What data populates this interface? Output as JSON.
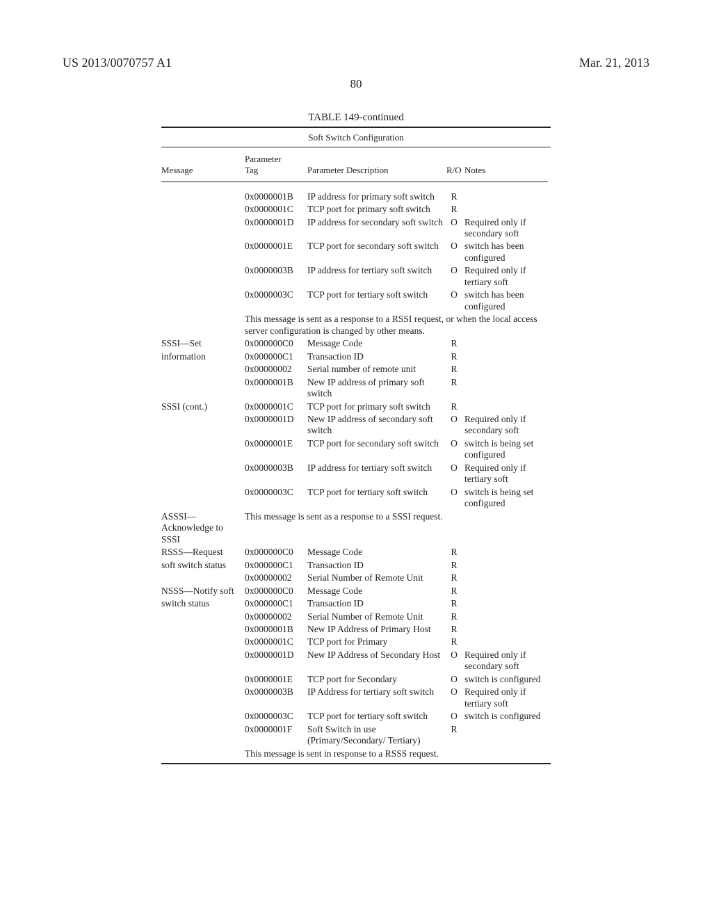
{
  "header": {
    "pub_number": "US 2013/0070757 A1",
    "pub_date": "Mar. 21, 2013",
    "page_number": "80"
  },
  "table": {
    "title": "TABLE 149-continued",
    "subtitle": "Soft Switch Configuration",
    "columns": {
      "message": "Message",
      "tag_top": "Parameter",
      "tag_bottom": "Tag",
      "desc": "Parameter Description",
      "ro": "R/O",
      "notes": "Notes"
    },
    "rows": [
      {
        "msg": "",
        "tag": "0x0000001B",
        "desc": "IP address for primary soft switch",
        "ro": "R",
        "notes": ""
      },
      {
        "msg": "",
        "tag": "0x0000001C",
        "desc": "TCP port for primary soft switch",
        "ro": "R",
        "notes": ""
      },
      {
        "msg": "",
        "tag": "0x0000001D",
        "desc": "IP address for secondary soft switch",
        "ro": "O",
        "notes": "Required only if secondary soft"
      },
      {
        "msg": "",
        "tag": "0x0000001E",
        "desc": "TCP port for secondary soft switch",
        "ro": "O",
        "notes": "switch has been configured"
      },
      {
        "msg": "",
        "tag": "0x0000003B",
        "desc": "IP address for tertiary soft switch",
        "ro": "O",
        "notes": "Required only if tertiary soft"
      },
      {
        "msg": "",
        "tag": "0x0000003C",
        "desc": "TCP port for tertiary soft switch",
        "ro": "O",
        "notes": "switch has been configured"
      },
      {
        "section_note": "This message is sent as a response to a RSSI request, or when the local access server configuration is changed by other means."
      },
      {
        "msg": "SSSI—Set",
        "tag": "0x000000C0",
        "desc": "Message Code",
        "ro": "R",
        "notes": ""
      },
      {
        "msg": "information",
        "tag": "0x000000C1",
        "desc": "Transaction ID",
        "ro": "R",
        "notes": ""
      },
      {
        "msg": "",
        "tag": "0x00000002",
        "desc": "Serial number of remote unit",
        "ro": "R",
        "notes": ""
      },
      {
        "msg": "",
        "tag": "0x0000001B",
        "desc": "New IP address of primary soft switch",
        "ro": "R",
        "notes": ""
      },
      {
        "msg": "SSSI (cont.)",
        "tag": "0x0000001C",
        "desc": "TCP port for primary soft switch",
        "ro": "R",
        "notes": ""
      },
      {
        "msg": "",
        "tag": "0x0000001D",
        "desc": "New IP address of secondary soft switch",
        "ro": "O",
        "notes": "Required only if secondary soft"
      },
      {
        "msg": "",
        "tag": "0x0000001E",
        "desc": "TCP port for secondary soft switch",
        "ro": "O",
        "notes": "switch is being set configured"
      },
      {
        "msg": "",
        "tag": "0x0000003B",
        "desc": "IP address for tertiary soft switch",
        "ro": "O",
        "notes": "Required only if tertiary soft"
      },
      {
        "msg": "",
        "tag": "0x0000003C",
        "desc": "TCP port for tertiary soft switch",
        "ro": "O",
        "notes": "switch is being set configured"
      },
      {
        "msg": "ASSSI—Acknowledge to SSSI",
        "section_note_right": "This message is sent as a response to a SSSI request."
      },
      {
        "msg": "RSSS—Request",
        "tag": "0x000000C0",
        "desc": "Message Code",
        "ro": "R",
        "notes": ""
      },
      {
        "msg": "soft switch status",
        "tag": "0x000000C1",
        "desc": "Transaction ID",
        "ro": "R",
        "notes": ""
      },
      {
        "msg": "",
        "tag": "0x00000002",
        "desc": "Serial Number of Remote Unit",
        "ro": "R",
        "notes": ""
      },
      {
        "msg": "NSSS—Notify soft",
        "tag": "0x000000C0",
        "desc": "Message Code",
        "ro": "R",
        "notes": ""
      },
      {
        "msg": "switch status",
        "tag": "0x000000C1",
        "desc": "Transaction ID",
        "ro": "R",
        "notes": ""
      },
      {
        "msg": "",
        "tag": "0x00000002",
        "desc": "Serial Number of Remote Unit",
        "ro": "R",
        "notes": ""
      },
      {
        "msg": "",
        "tag": "0x0000001B",
        "desc": "New IP Address of Primary Host",
        "ro": "R",
        "notes": ""
      },
      {
        "msg": "",
        "tag": "0x0000001C",
        "desc": "TCP port for Primary",
        "ro": "R",
        "notes": ""
      },
      {
        "msg": "",
        "tag": "0x0000001D",
        "desc": "New IP Address of Secondary Host",
        "ro": "O",
        "notes": "Required only if secondary soft"
      },
      {
        "msg": "",
        "tag": "0x0000001E",
        "desc": "TCP port for Secondary",
        "ro": "O",
        "notes": "switch is configured"
      },
      {
        "msg": "",
        "tag": "0x0000003B",
        "desc": "IP Address for tertiary soft switch",
        "ro": "O",
        "notes": "Required only if tertiary soft"
      },
      {
        "msg": "",
        "tag": "0x0000003C",
        "desc": "TCP port for tertiary soft switch",
        "ro": "O",
        "notes": "switch is configured"
      },
      {
        "msg": "",
        "tag": "0x0000001F",
        "desc": "Soft Switch in use (Primary/Secondary/ Tertiary)",
        "ro": "R",
        "notes": ""
      },
      {
        "section_note": "This message is sent in response to a RSSS request."
      }
    ]
  }
}
